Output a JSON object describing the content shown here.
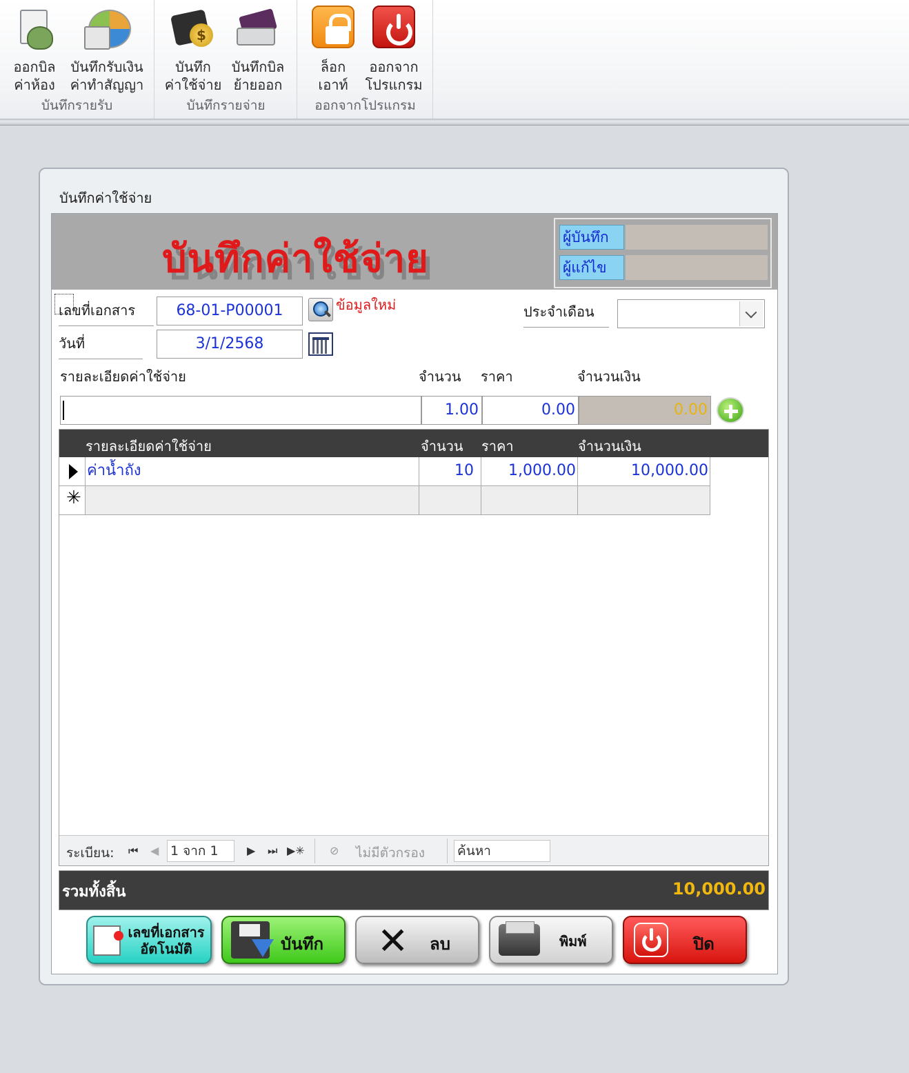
{
  "ribbon": {
    "groups": [
      {
        "name": "บันทึกรายรับ",
        "buttons": [
          {
            "line1": "ออกบิล",
            "line2": "ค่าห้อง",
            "icon": "bill-icon"
          },
          {
            "line1": "บันทึกรับเงิน",
            "line2": "ค่าทำสัญญา",
            "icon": "pie-chart-icon"
          }
        ]
      },
      {
        "name": "บันทึกรายจ่าย",
        "buttons": [
          {
            "line1": "บันทึก",
            "line2": "ค่าใช้จ่าย",
            "icon": "wallet-icon"
          },
          {
            "line1": "บันทึกบิล",
            "line2": "ย้ายออก",
            "icon": "card-icon"
          }
        ]
      },
      {
        "name": "ออกจากโปรแกรม",
        "buttons": [
          {
            "line1": "ล็อก",
            "line2": "เอาท์",
            "icon": "lock-icon"
          },
          {
            "line1": "ออกจาก",
            "line2": "โปรแกรม",
            "icon": "power-icon"
          }
        ]
      }
    ]
  },
  "form": {
    "panel_title": "บันทึกค่าใช้จ่าย",
    "big_title": "บันทึกค่าใช้จ่าย",
    "recorder_label": "ผู้บันทึก",
    "recorder_value": "",
    "editor_label": "ผู้แก้ไข",
    "editor_value": "",
    "doc_no_label": "เลขที่เอกสาร",
    "doc_no_value": "68-01-P00001",
    "new_data_label": "ข้อมูลใหม่",
    "date_label": "วันที่",
    "date_value": "3/1/2568",
    "month_label": "ประจำเดือน",
    "month_value": ""
  },
  "entry": {
    "desc_header": "รายละเอียดค่าใช้จ่าย",
    "qty_header": "จำนวน",
    "price_header": "ราคา",
    "amount_header": "จำนวนเงิน",
    "desc_value": "",
    "qty_value": "1.00",
    "price_value": "0.00",
    "amount_value": "0.00"
  },
  "grid": {
    "columns": [
      "รายละเอียดค่าใช้จ่าย",
      "จำนวน",
      "ราคา",
      "จำนวนเงิน"
    ],
    "rows": [
      {
        "desc": "ค่าน้ำถัง",
        "qty": "10",
        "price": "1,000.00",
        "amount": "10,000.00"
      }
    ],
    "nav": {
      "record_label": "ระเบียน:",
      "position": "1 จาก 1",
      "filter_label": "ไม่มีตัวกรอง",
      "search_label": "ค้นหา"
    }
  },
  "total": {
    "label": "รวมทั้งสิ้น",
    "value": "10,000.00"
  },
  "actions": {
    "auto_line1": "เลขที่เอกสาร",
    "auto_line2": "อัตโนมัติ",
    "save": "บันทึก",
    "delete": "ลบ",
    "print": "พิมพ์",
    "close": "ปิด"
  },
  "colors": {
    "accent_red": "#e01a1a",
    "value_blue": "#1b33d6",
    "total_gold": "#f0b70f",
    "grid_header": "#3d3d3d"
  }
}
